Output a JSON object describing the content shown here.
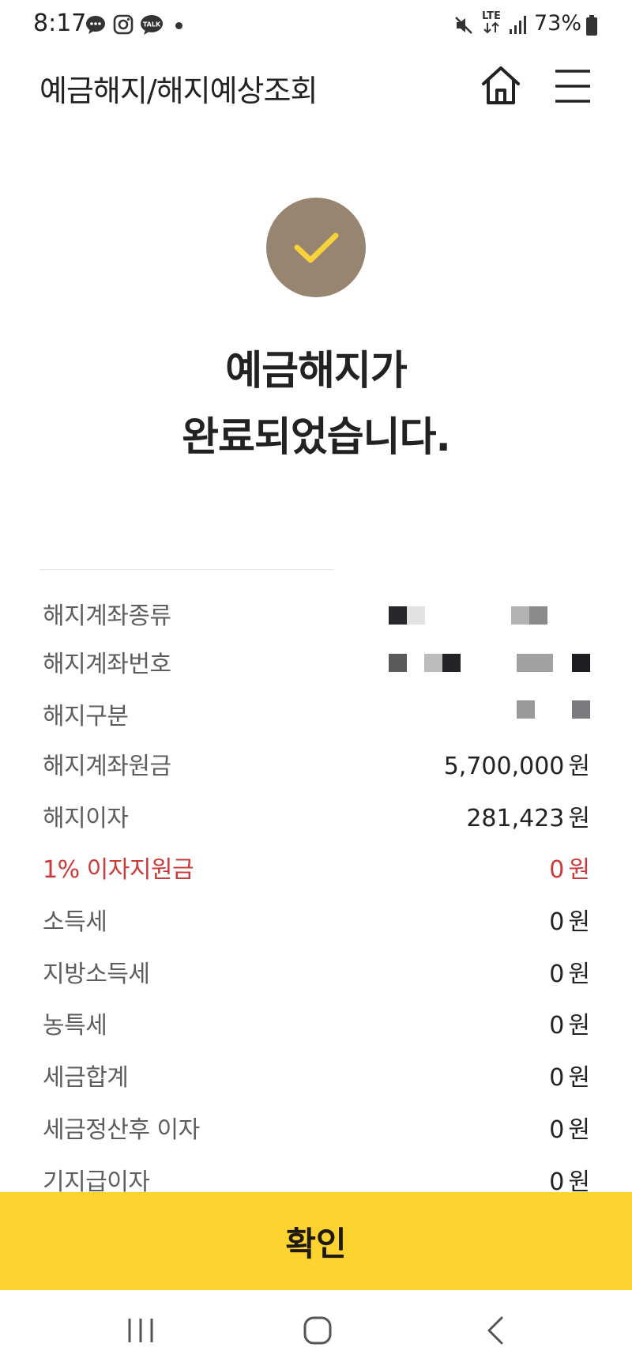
{
  "status_bar": {
    "time": "8:17",
    "battery": "73%",
    "network": "LTE",
    "icons": [
      "chat-bubble-icon",
      "instagram-icon",
      "talk-icon",
      "mute-icon",
      "lte-icon",
      "signal-icon",
      "battery-icon"
    ],
    "talk_badge": "TALK"
  },
  "header": {
    "title": "예금해지/해지예상조회",
    "icons": [
      "home-icon",
      "menu-icon"
    ]
  },
  "result": {
    "line1": "예금해지가",
    "line2": "완료되었습니다.",
    "icon": "check-icon"
  },
  "details": [
    {
      "label": "해지계좌종류",
      "value": "",
      "unit": ""
    },
    {
      "label": "해지계좌번호",
      "value": "",
      "unit": ""
    },
    {
      "label": "해지구분",
      "value": "",
      "unit": ""
    },
    {
      "label": "해지계좌원금",
      "value": "5,700,000",
      "unit": "원"
    },
    {
      "label": "해지이자",
      "value": "281,423",
      "unit": "원"
    },
    {
      "label": "1% 이자지원금",
      "value": "0",
      "unit": "원"
    },
    {
      "label": "소득세",
      "value": "0",
      "unit": "원"
    },
    {
      "label": "지방소득세",
      "value": "0",
      "unit": "원"
    },
    {
      "label": "농특세",
      "value": "0",
      "unit": "원"
    },
    {
      "label": "세금합계",
      "value": "0",
      "unit": "원"
    },
    {
      "label": "세금정산후 이자",
      "value": "0",
      "unit": "원"
    },
    {
      "label": "기지급이자",
      "value": "0",
      "unit": "원"
    }
  ],
  "confirm_label": "확인",
  "nav": [
    "recent-apps-icon",
    "home-circle-icon",
    "back-icon"
  ],
  "colors": {
    "accent_yellow": "#fdd330",
    "check_circle": "#978572",
    "checkmark": "#f8d23a",
    "red_text": "#cc3a3a"
  }
}
